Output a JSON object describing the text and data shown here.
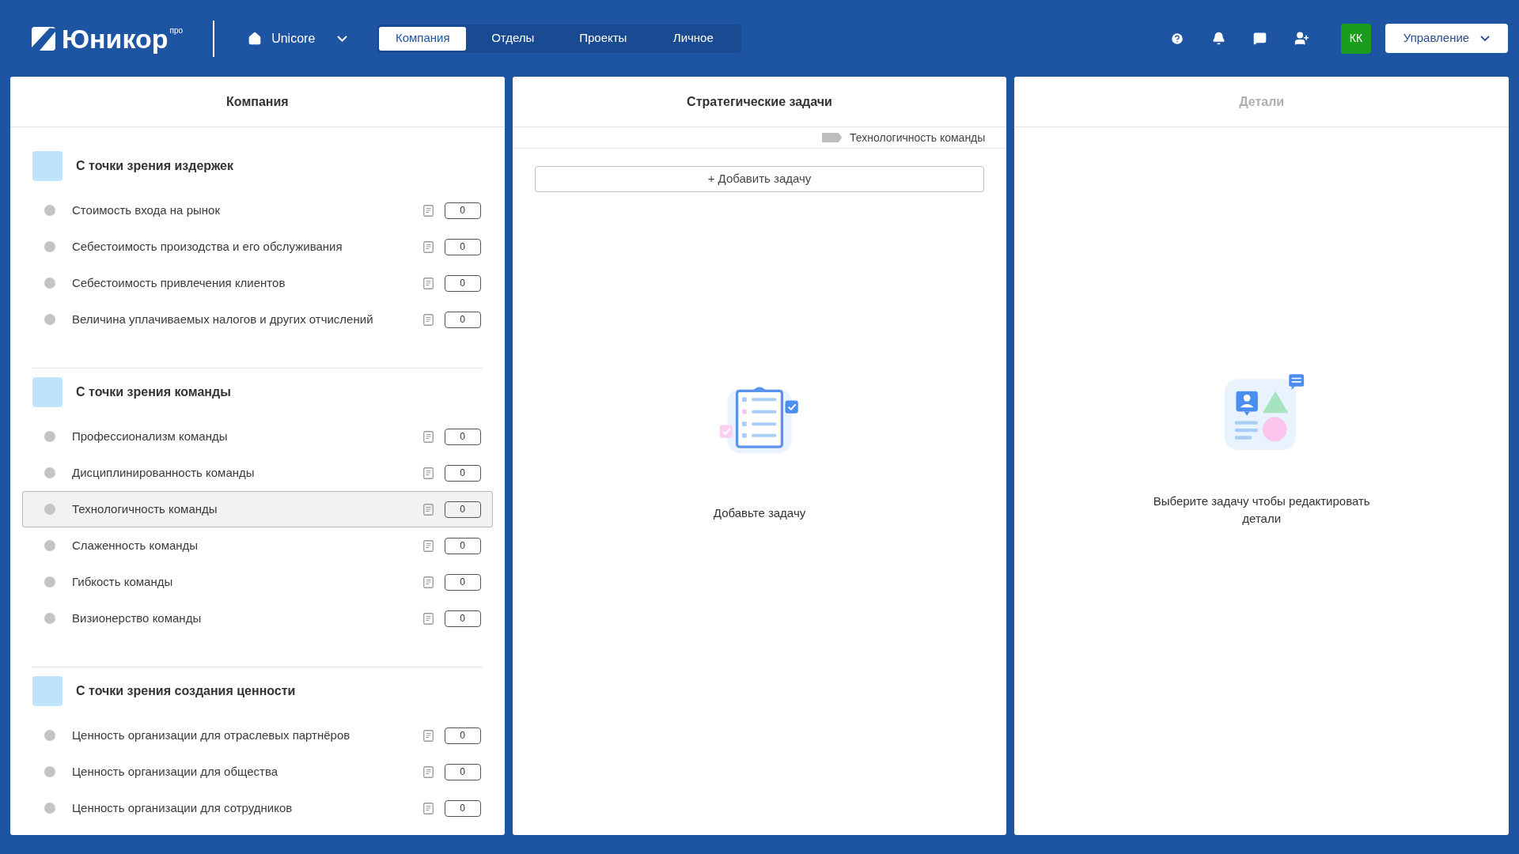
{
  "header": {
    "logo": {
      "name": "Юникор",
      "badge": "про"
    },
    "workspace": "Unicore",
    "tabs": [
      {
        "label": "Компания",
        "selected": true
      },
      {
        "label": "Отделы",
        "selected": false
      },
      {
        "label": "Проекты",
        "selected": false
      },
      {
        "label": "Личное",
        "selected": false
      }
    ],
    "avatar": "КК",
    "menu_button": "Управление"
  },
  "company_panel": {
    "title": "Компания",
    "groups": [
      {
        "title": "С точки зрения издержек",
        "items": [
          {
            "label": "Стоимость входа на рынок",
            "count": "0",
            "selected": false
          },
          {
            "label": "Себестоимость произодства и его обслуживания",
            "count": "0",
            "selected": false
          },
          {
            "label": "Себестоимость привлечения клиентов",
            "count": "0",
            "selected": false
          },
          {
            "label": "Величина уплачиваемых налогов и других отчислений",
            "count": "0",
            "selected": false
          }
        ]
      },
      {
        "title": "С точки зрения команды",
        "items": [
          {
            "label": "Профессионализм команды",
            "count": "0",
            "selected": false
          },
          {
            "label": "Дисциплинированность команды",
            "count": "0",
            "selected": false
          },
          {
            "label": "Технологичность команды",
            "count": "0",
            "selected": true
          },
          {
            "label": "Слаженность команды",
            "count": "0",
            "selected": false
          },
          {
            "label": "Гибкость команды",
            "count": "0",
            "selected": false
          },
          {
            "label": "Визионерство команды",
            "count": "0",
            "selected": false
          }
        ]
      },
      {
        "title": "С точки зрения создания ценности",
        "items": [
          {
            "label": "Ценность организации для отраслевых партнёров",
            "count": "0",
            "selected": false
          },
          {
            "label": "Ценность организации для общества",
            "count": "0",
            "selected": false
          },
          {
            "label": "Ценность организации для сотрудников",
            "count": "0",
            "selected": false
          }
        ]
      }
    ]
  },
  "tasks_panel": {
    "title": "Стратегические задачи",
    "filter_tag": "Технологичность команды",
    "add_button": "+ Добавить задачу",
    "empty_text": "Добавьте задачу"
  },
  "details_panel": {
    "title": "Детали",
    "empty_text": "Выберите задачу чтобы редактировать детали"
  }
}
